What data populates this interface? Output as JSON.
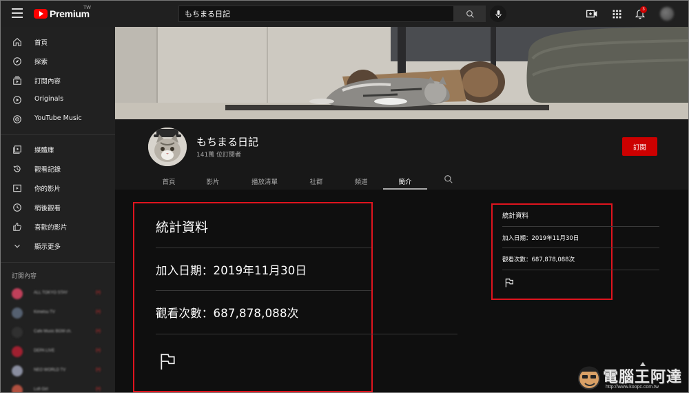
{
  "app": {
    "logo_text": "Premium",
    "region": "TW"
  },
  "search": {
    "value": "もちまる日記",
    "placeholder": "搜尋"
  },
  "topbar": {
    "notification_count": "3"
  },
  "sidebar": {
    "main_items": [
      {
        "label": "首頁",
        "icon": "home-icon"
      },
      {
        "label": "探索",
        "icon": "compass-icon"
      },
      {
        "label": "訂閱內容",
        "icon": "subscriptions-icon"
      },
      {
        "label": "Originals",
        "icon": "originals-icon"
      },
      {
        "label": "YouTube Music",
        "icon": "music-icon"
      }
    ],
    "library_items": [
      {
        "label": "媒體庫",
        "icon": "library-icon"
      },
      {
        "label": "觀看記錄",
        "icon": "history-icon"
      },
      {
        "label": "你的影片",
        "icon": "your-videos-icon"
      },
      {
        "label": "稍後觀看",
        "icon": "watch-later-icon"
      },
      {
        "label": "喜歡的影片",
        "icon": "thumbs-up-icon"
      },
      {
        "label": "顯示更多",
        "icon": "chevron-down-icon"
      }
    ],
    "subscriptions_heading": "訂閱內容",
    "subscriptions": [
      {
        "name": "ALL TOKYO STAY",
        "live": "(•)"
      },
      {
        "name": "Kimetsu TV",
        "live": "(•)"
      },
      {
        "name": "Cafe Music BGM ch.",
        "live": "(•)"
      },
      {
        "name": "DEPA LIVE",
        "live": "(•)"
      },
      {
        "name": "NEO WORLD TV",
        "live": "(•)"
      },
      {
        "name": "Lofi Girl",
        "live": "(•)"
      }
    ]
  },
  "channel": {
    "name": "もちまる日記",
    "subscribers": "141萬 位訂閱者",
    "subscribe_label": "訂閱",
    "tabs": [
      "首頁",
      "影片",
      "播放清單",
      "社群",
      "頻道",
      "簡介"
    ],
    "active_tab": "簡介"
  },
  "stats": {
    "title": "統計資料",
    "joined": "加入日期：2019年11月30日",
    "views": "觀看次數：687,878,088次"
  },
  "watermark": {
    "text": "電腦王阿達",
    "url": "http://www.koopc.com.tw"
  },
  "colors": {
    "accent_red": "#cc0000",
    "highlight_border": "#e0141e",
    "background": "#181818"
  }
}
